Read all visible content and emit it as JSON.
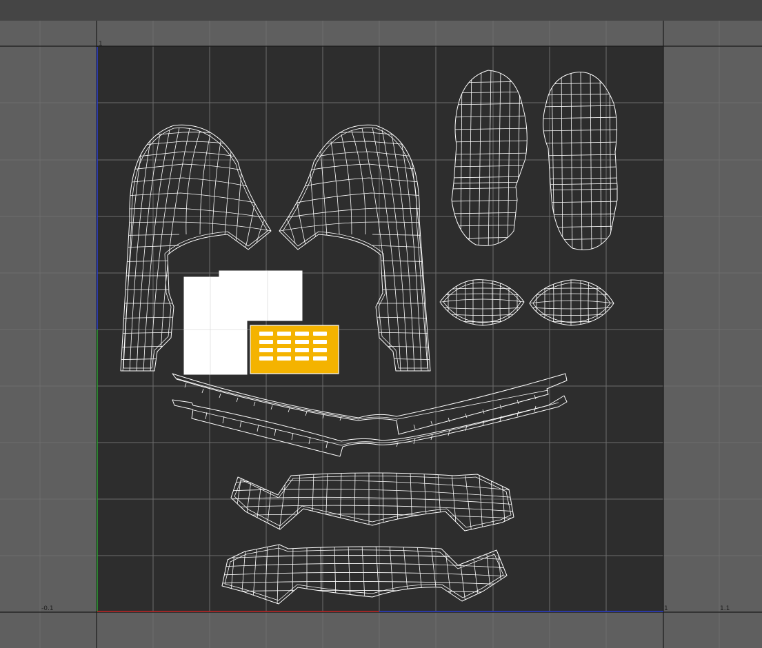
{
  "window": {
    "title_bar": ""
  },
  "uv_editor": {
    "labels": {
      "top_left": "1",
      "bottom_left": "-0.1",
      "bottom_right_1": "1",
      "bottom_right_2": "1.1"
    },
    "colors": {
      "background": "#5f5f5f",
      "uv_square": "#2d2d2d",
      "wireframe": "#ffffff",
      "selected_face": "#f4b300",
      "axis_u": "#c62828",
      "axis_v": "#2e7d32",
      "axis_blue": "#2c3fd0"
    },
    "shells": [
      "left-sleeve-shell",
      "right-sleeve-shell",
      "boot-sole-left-shell",
      "boot-sole-right-shell",
      "left-eye-shell",
      "right-eye-shell",
      "belt-strap-shell-1",
      "belt-strap-shell-2",
      "torso-band-shell-1",
      "torso-band-shell-2",
      "white-panel-shell",
      "selected-grid-shell"
    ]
  }
}
